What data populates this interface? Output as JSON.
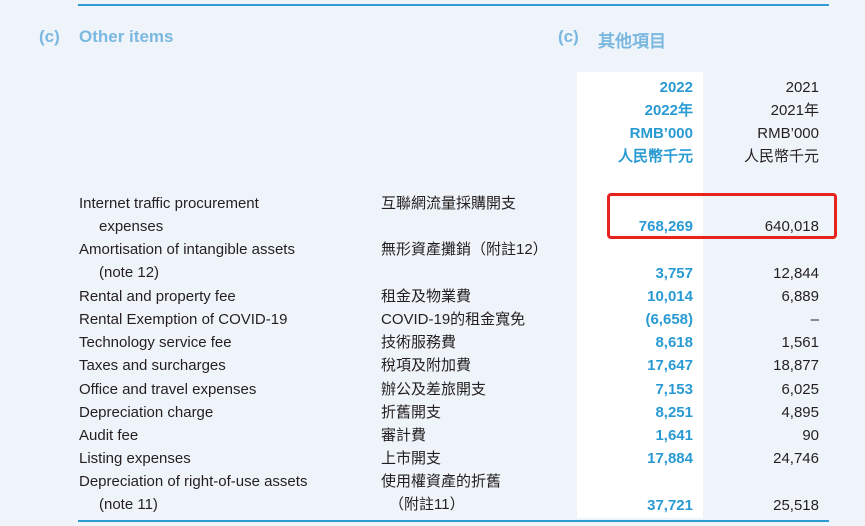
{
  "section": {
    "marker_en": "(c)",
    "title_en": "Other items",
    "marker_zh": "(c)",
    "title_zh": "其他項目"
  },
  "columns": {
    "current": {
      "year": "2022",
      "year_zh": "2022年",
      "unit": "RMB’000",
      "unit_zh": "人民幣千元"
    },
    "prior": {
      "year": "2021",
      "year_zh": "2021年",
      "unit": "RMB’000",
      "unit_zh": "人民幣千元"
    }
  },
  "rows": [
    {
      "en": "Internet traffic procurement",
      "en_cont": "expenses",
      "zh": "互聯網流量採購開支",
      "zh_cont": "",
      "v2022": "768,269",
      "v2021": "640,018"
    },
    {
      "en": "Amortisation of intangible assets",
      "en_cont": "(note 12)",
      "zh": "無形資產攤銷（附註12）",
      "zh_cont": "",
      "v2022": "3,757",
      "v2021": "12,844"
    },
    {
      "en": "Rental and property fee",
      "en_cont": "",
      "zh": "租金及物業費",
      "zh_cont": "",
      "v2022": "10,014",
      "v2021": "6,889"
    },
    {
      "en": "Rental Exemption of COVID-19",
      "en_cont": "",
      "zh": "COVID-19的租金寬免",
      "zh_cont": "",
      "v2022": "(6,658)",
      "v2021": "–"
    },
    {
      "en": "Technology service fee",
      "en_cont": "",
      "zh": "技術服務費",
      "zh_cont": "",
      "v2022": "8,618",
      "v2021": "1,561"
    },
    {
      "en": "Taxes and surcharges",
      "en_cont": "",
      "zh": "稅項及附加費",
      "zh_cont": "",
      "v2022": "17,647",
      "v2021": "18,877"
    },
    {
      "en": "Office and travel expenses",
      "en_cont": "",
      "zh": "辦公及差旅開支",
      "zh_cont": "",
      "v2022": "7,153",
      "v2021": "6,025"
    },
    {
      "en": "Depreciation charge",
      "en_cont": "",
      "zh": "折舊開支",
      "zh_cont": "",
      "v2022": "8,251",
      "v2021": "4,895"
    },
    {
      "en": "Audit fee",
      "en_cont": "",
      "zh": "審計費",
      "zh_cont": "",
      "v2022": "1,641",
      "v2021": "90"
    },
    {
      "en": "Listing expenses",
      "en_cont": "",
      "zh": "上市開支",
      "zh_cont": "",
      "v2022": "17,884",
      "v2021": "24,746"
    },
    {
      "en": "Depreciation of right-of-use assets",
      "en_cont": "(note 11)",
      "zh": "使用權資產的折舊",
      "zh_cont": "（附註11）",
      "v2022": "37,721",
      "v2021": "25,518"
    }
  ],
  "colors": {
    "accent_blue": "#2a9ad3",
    "heading_blue": "#7ab8e0",
    "highlight_red": "#e8231f"
  }
}
